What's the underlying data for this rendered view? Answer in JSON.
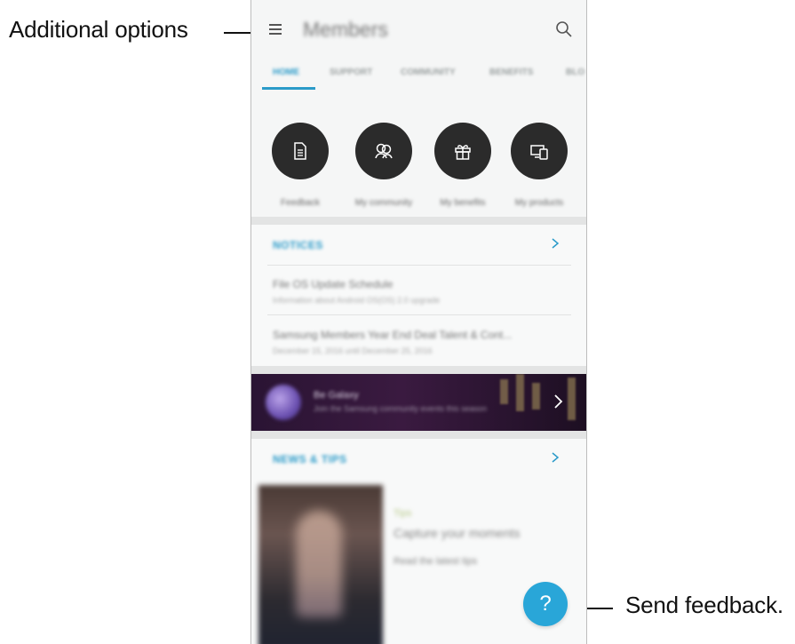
{
  "callouts": {
    "additional_options": "Additional options",
    "send_feedback": "Send feedback."
  },
  "app": {
    "title": "Members",
    "tabs": [
      "HOME",
      "SUPPORT",
      "COMMUNITY",
      "BENEFITS",
      "BLO"
    ],
    "active_tab": "HOME",
    "quick_actions": [
      {
        "icon": "document-icon",
        "label": "Feedback"
      },
      {
        "icon": "community-icon",
        "label": "My community"
      },
      {
        "icon": "gift-icon",
        "label": "My benefits"
      },
      {
        "icon": "devices-icon",
        "label": "My products"
      }
    ],
    "notices": {
      "heading": "NOTICES",
      "items": [
        {
          "title": "File OS Update Schedule",
          "subtitle": "Information about Android OS(OS) 2.0 upgrade"
        },
        {
          "title": "Samsung Members Year End Deal Talent & Cont...",
          "subtitle": "December 15, 2016 until December 25, 2016"
        }
      ]
    },
    "banner": {
      "title": "Be Galaxy",
      "subtitle": "Join the Samsung community events this season"
    },
    "news": {
      "heading": "NEWS & TIPS",
      "items": [
        "Tips",
        "Capture your moments",
        "Read the latest tips"
      ]
    },
    "fab_icon": "?"
  },
  "colors": {
    "accent": "#2b9bc9",
    "fab": "#29a6d8",
    "icon_circle": "#2b2b2b"
  }
}
